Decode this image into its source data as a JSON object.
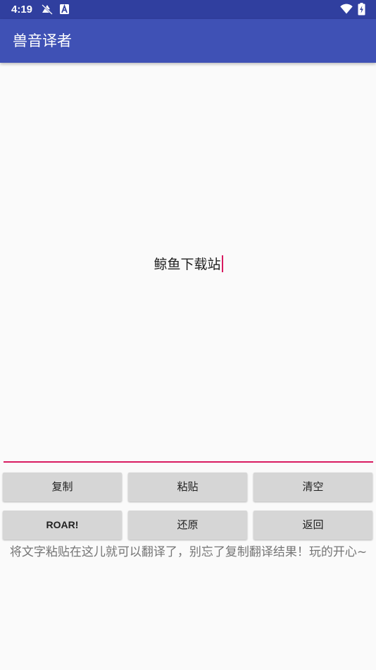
{
  "status_bar": {
    "time": "4:19",
    "icons_left": [
      "muted-notification-icon",
      "app-a-icon"
    ],
    "icons_right": [
      "wifi-icon",
      "battery-charging-icon"
    ]
  },
  "app_bar": {
    "title": "兽音译者"
  },
  "editor": {
    "value": "鲸鱼下载站"
  },
  "buttons": {
    "copy": "复制",
    "paste": "粘贴",
    "clear": "清空",
    "roar": "ROAR!",
    "restore": "还原",
    "back": "返回"
  },
  "hint": "将文字粘贴在这儿就可以翻译了，别忘了复制翻译结果！玩的开心~",
  "colors": {
    "status_bar": "#303f9f",
    "app_bar": "#3f51b5",
    "accent": "#d81b60",
    "button_bg": "#d6d6d6",
    "background": "#fafafa"
  }
}
